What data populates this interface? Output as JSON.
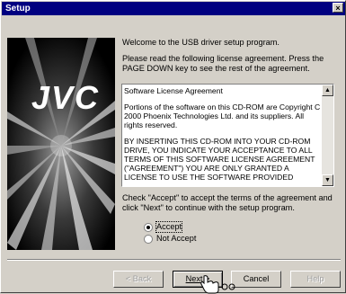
{
  "window": {
    "title": "Setup",
    "close_glyph": "×"
  },
  "brand": {
    "logo_text": "JVC"
  },
  "intro": {
    "welcome": "Welcome to the USB driver setup program.",
    "instructions": "Please read the following license agreement.  Press the PAGE DOWN key to see the rest of the agreement."
  },
  "license": {
    "paragraphs": [
      "Software License Agreement",
      "Portions of the software on this CD-ROM are Copyright C 2000 Phoenix Technologies Ltd. and its suppliers. All rights reserved.",
      "BY INSERTING THIS CD-ROM INTO YOUR CD-ROM DRIVE, YOU INDICATE YOUR ACCEPTANCE TO ALL TERMS OF THIS SOFTWARE LICENSE AGREEMENT (\"AGREEMENT\") YOU ARE ONLY GRANTED A LICENSE TO USE THE SOFTWARE PROVIDED"
    ]
  },
  "instruction_text": "Check \"Accept\" to accept the terms of the agreement and click \"Next\" to continue with the setup program.",
  "options": {
    "accept": "Accept",
    "not_accept": "Not Accept",
    "selected": "accept"
  },
  "buttons": {
    "back": "< Back",
    "next": "Next >",
    "cancel": "Cancel",
    "help": "Help"
  },
  "icons": {
    "scroll_up": "scroll-up-arrow-icon",
    "scroll_down": "scroll-down-arrow-icon",
    "cursor": "hand-pointer-icon"
  }
}
